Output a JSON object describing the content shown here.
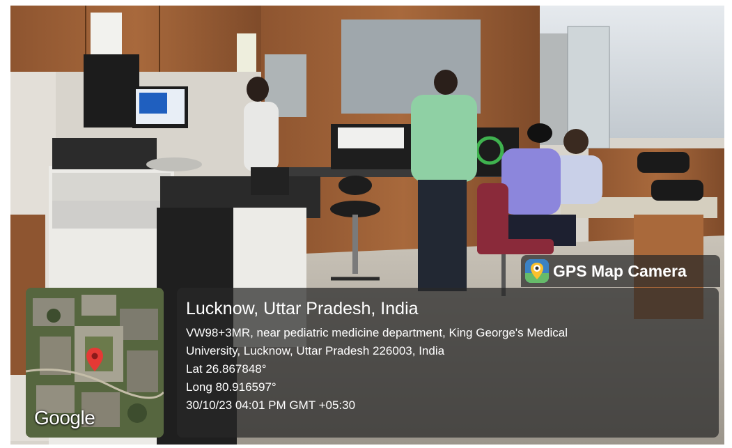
{
  "location_title": "Lucknow, Uttar Pradesh, India",
  "address_line_1": "VW98+3MR, near pediatric medicine department, King George's Medical",
  "address_line_2": "University, Lucknow, Uttar Pradesh 226003, India",
  "latitude": "Lat 26.867848°",
  "longitude": "Long 80.916597°",
  "timestamp": "30/10/23 04:01 PM GMT +05:30",
  "app_badge": "GPS Map Camera",
  "map_logo": "Google",
  "icons": {
    "badge_icon": "gps-map-camera-app-icon",
    "pin_icon": "location-pin-icon"
  },
  "colors": {
    "overlay": "#282828",
    "pin": "#e53935",
    "cabinet_wood": "#a0623a"
  }
}
